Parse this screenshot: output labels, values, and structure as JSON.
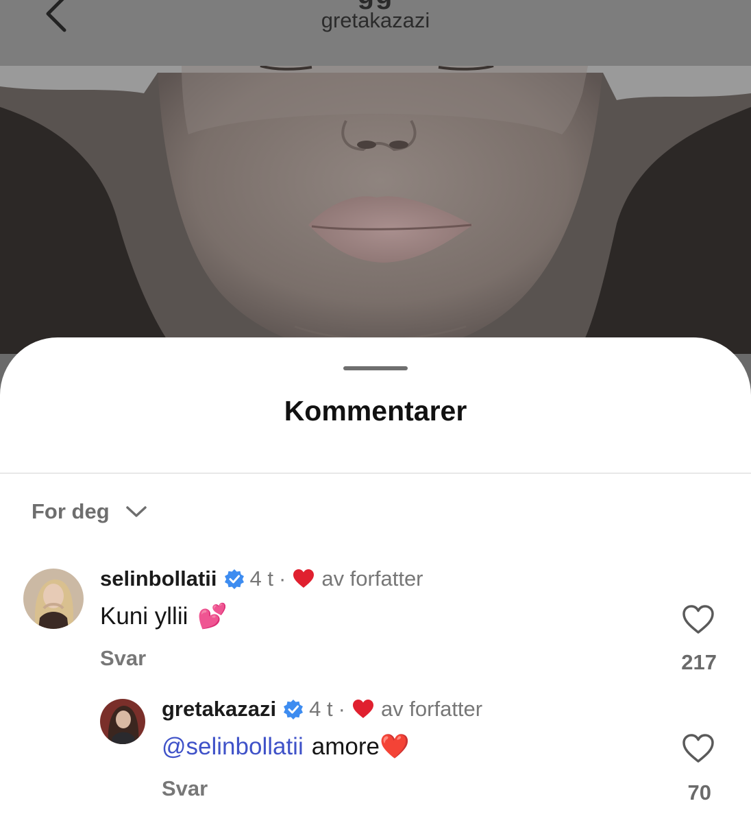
{
  "header": {
    "title_partial": "gg",
    "username": "gretakazazi"
  },
  "sheet": {
    "title": "Kommentarer",
    "sort_label": "For deg"
  },
  "comments": [
    {
      "username": "selinbollatii",
      "verified": true,
      "time": "4 t",
      "separator": "·",
      "author_like_label": "av forfatter",
      "text": "Kuni yllii",
      "emoji": "💕",
      "reply_label": "Svar",
      "like_count": "217",
      "replies": [
        {
          "username": "gretakazazi",
          "verified": true,
          "time": "4 t",
          "separator": "·",
          "author_like_label": "av forfatter",
          "mention": "@selinbollatii",
          "text": "amore",
          "emoji": "❤️",
          "reply_label": "Svar",
          "like_count": "70"
        }
      ]
    }
  ],
  "colors": {
    "mention": "#3f52c8",
    "verified": "#3d8cf0",
    "author_heart": "#e0202f",
    "muted_text": "#777777"
  },
  "icons": [
    "back-chevron-icon",
    "chevron-down-icon",
    "verified-badge-icon",
    "heart-icon",
    "heart-outline-icon"
  ]
}
